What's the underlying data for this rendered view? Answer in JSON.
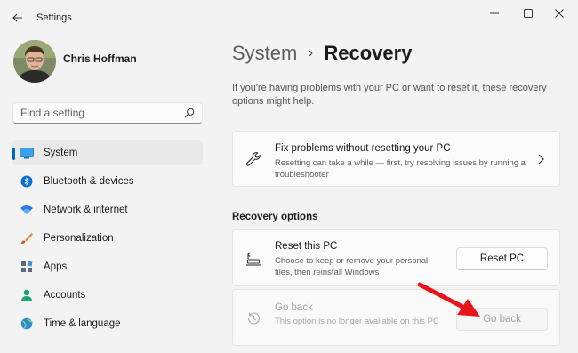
{
  "window": {
    "app_title": "Settings",
    "back_icon": "back-arrow-icon",
    "controls": [
      "minimize-icon",
      "maximize-icon",
      "close-icon"
    ]
  },
  "profile": {
    "name": "Chris Hoffman"
  },
  "search": {
    "placeholder": "Find a setting",
    "value": ""
  },
  "sidebar": {
    "items": [
      {
        "label": "System",
        "icon": "system-icon",
        "active": true
      },
      {
        "label": "Bluetooth & devices",
        "icon": "bluetooth-icon"
      },
      {
        "label": "Network & internet",
        "icon": "network-icon"
      },
      {
        "label": "Personalization",
        "icon": "brush-icon"
      },
      {
        "label": "Apps",
        "icon": "apps-icon"
      },
      {
        "label": "Accounts",
        "icon": "accounts-icon"
      },
      {
        "label": "Time & language",
        "icon": "globe-icon"
      }
    ]
  },
  "main": {
    "breadcrumb_parent": "System",
    "breadcrumb_current": "Recovery",
    "intro": "If you're having problems with your PC or want to reset it, these recovery options might help.",
    "fix_card": {
      "title": "Fix problems without resetting your PC",
      "desc": "Resetting can take a while — first, try resolving issues by running a troubleshooter"
    },
    "section_heading": "Recovery options",
    "reset_card": {
      "title": "Reset this PC",
      "desc": "Choose to keep or remove your personal files, then reinstall Windows",
      "button": "Reset PC"
    },
    "goback_card": {
      "title": "Go back",
      "desc": "This option is no longer available on this PC",
      "button": "Go back"
    }
  },
  "colors": {
    "accent": "#0067c0",
    "annotation_arrow": "#e8141c"
  }
}
